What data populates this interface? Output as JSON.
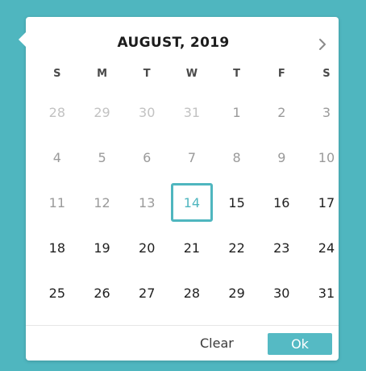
{
  "calendar": {
    "month_title": "AUGUST, 2019",
    "next_icon": "chevron-right-icon",
    "weekdays": [
      "S",
      "M",
      "T",
      "W",
      "T",
      "F",
      "S"
    ],
    "weeks": [
      [
        "28",
        "29",
        "30",
        "31",
        "1",
        "2",
        "3"
      ],
      [
        "4",
        "5",
        "6",
        "7",
        "8",
        "9",
        "10"
      ],
      [
        "11",
        "12",
        "13",
        "14",
        "15",
        "16",
        "17"
      ],
      [
        "18",
        "19",
        "20",
        "21",
        "22",
        "23",
        "24"
      ],
      [
        "25",
        "26",
        "27",
        "28",
        "29",
        "30",
        "31"
      ]
    ],
    "selected_day": "14"
  },
  "footer": {
    "clear_label": "Clear",
    "ok_label": "Ok"
  },
  "colors": {
    "background": "#4fb6bf",
    "accent": "#55bac4",
    "selected_border": "#4fb6bf"
  }
}
